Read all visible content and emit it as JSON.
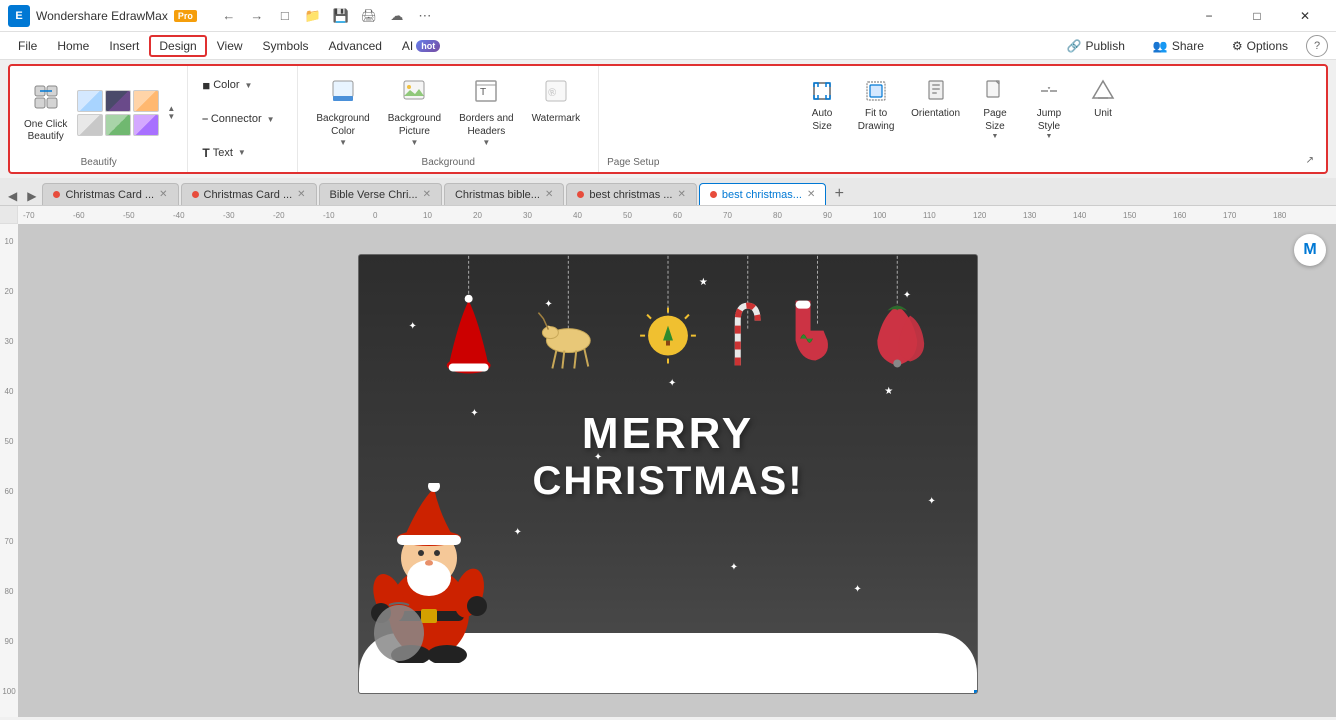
{
  "app": {
    "name": "Wondershare EdrawMax",
    "badge": "Pro",
    "logo_letter": "E"
  },
  "title_bar": {
    "buttons": [
      "undo",
      "redo",
      "new_tab",
      "open",
      "save",
      "print",
      "cloud_save",
      "more"
    ]
  },
  "menu": {
    "items": [
      "File",
      "Home",
      "Insert",
      "Design",
      "View",
      "Symbols",
      "Advanced",
      "AI"
    ],
    "active": "Design",
    "ai_badge": "hot",
    "right_actions": [
      "Publish",
      "Share",
      "Options",
      "Help"
    ]
  },
  "ribbon": {
    "sections": [
      {
        "id": "beautify",
        "label": "Beautify",
        "one_click_label": "One Click\nBeautify",
        "swatches": [
          "blue",
          "dark",
          "orange",
          "gray",
          "green",
          "mixed"
        ]
      },
      {
        "id": "format",
        "label": "",
        "color_label": "Color",
        "connector_label": "Connector",
        "text_label": "Text"
      },
      {
        "id": "background",
        "label": "Background",
        "tools": [
          "Background Color",
          "Background Picture",
          "Borders and Headers",
          "Watermark"
        ]
      },
      {
        "id": "page_setup",
        "label": "Page Setup",
        "tools": [
          "Auto Size",
          "Fit to Drawing",
          "Orientation",
          "Page Size",
          "Jump Style",
          "Unit"
        ]
      }
    ]
  },
  "tabs": [
    {
      "id": 1,
      "label": "Christmas Card ...",
      "dot_color": "#e74c3c",
      "active": false,
      "closeable": true
    },
    {
      "id": 2,
      "label": "Christmas Card ...",
      "dot_color": "#e74c3c",
      "active": false,
      "closeable": true
    },
    {
      "id": 3,
      "label": "Bible Verse Chri...",
      "dot_color": null,
      "active": false,
      "closeable": true
    },
    {
      "id": 4,
      "label": "Christmas bible...",
      "dot_color": null,
      "active": false,
      "closeable": true
    },
    {
      "id": 5,
      "label": "best christmas ...",
      "dot_color": "#e74c3c",
      "active": false,
      "closeable": true
    },
    {
      "id": 6,
      "label": "best christmas...",
      "dot_color": "#e74c3c",
      "active": true,
      "closeable": true
    }
  ],
  "canvas": {
    "card_title": "MERRY\nCHRISTMAS!",
    "merry_line": "MERRY",
    "christmas_line": "CHRISTMAS!"
  },
  "labels": {
    "publish": "Publish",
    "share": "Share",
    "options": "Options",
    "one_click_beautify": "One Click Beautify",
    "color": "Color",
    "connector": "Connector",
    "text": "Text",
    "background_color": "Background\nColor",
    "background_picture": "Background\nPicture",
    "borders_headers": "Borders and\nHeaders",
    "watermark": "Watermark",
    "auto_size": "Auto\nSize",
    "fit_to_drawing": "Fit to\nDrawing",
    "orientation": "Orientation",
    "page_size": "Page\nSize",
    "jump_style": "Jump\nStyle",
    "unit": "Unit",
    "beautify_label": "Beautify",
    "background_label": "Background",
    "page_setup_label": "Page Setup"
  }
}
